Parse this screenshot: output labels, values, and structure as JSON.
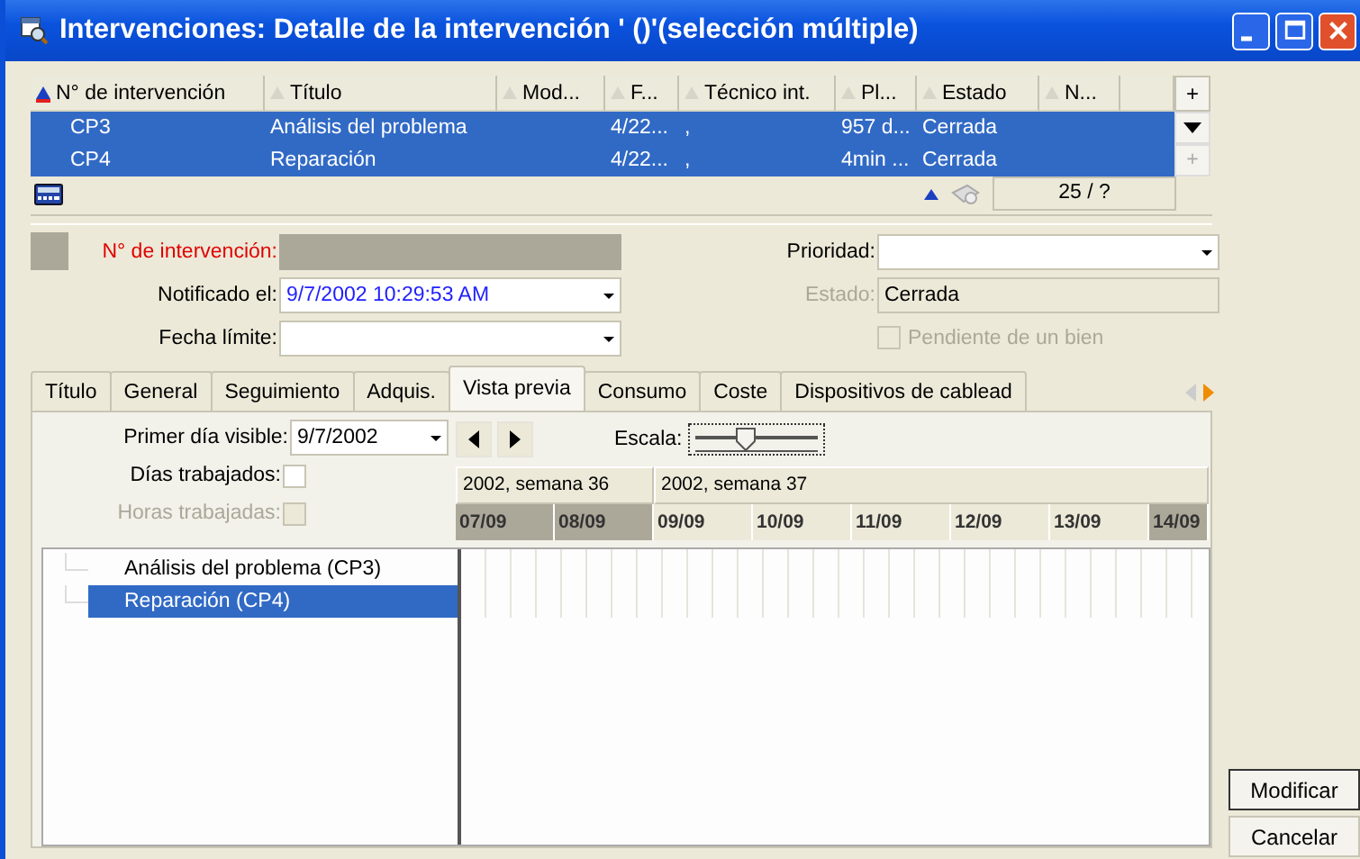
{
  "window": {
    "title": "Intervenciones: Detalle de la intervención ' ()'(selección múltiple)"
  },
  "list": {
    "columns": [
      {
        "label": "N° de intervención",
        "sorted": true
      },
      {
        "label": "Título",
        "sorted": false
      },
      {
        "label": "Mod...",
        "sorted": false
      },
      {
        "label": "F...",
        "sorted": false
      },
      {
        "label": "Técnico int.",
        "sorted": false
      },
      {
        "label": "Pl...",
        "sorted": false
      },
      {
        "label": "Estado",
        "sorted": false
      },
      {
        "label": "N...",
        "sorted": false
      }
    ],
    "rows": [
      {
        "selected": true,
        "cells": [
          "CP3",
          "Análisis del problema",
          "",
          "4/22...",
          ",",
          "957 d...",
          "Cerrada",
          ""
        ]
      },
      {
        "selected": true,
        "cells": [
          "CP4",
          "Reparación",
          "",
          "4/22...",
          ",",
          "4min ...",
          "Cerrada",
          ""
        ]
      }
    ],
    "add_label": "+",
    "counter": "25 / ?"
  },
  "form": {
    "number": {
      "label": "N° de intervención:",
      "required": true
    },
    "notified": {
      "label": "Notificado el:",
      "value": "9/7/2002 10:29:53 AM"
    },
    "deadline": {
      "label": "Fecha límite:"
    },
    "priority": {
      "label": "Prioridad:"
    },
    "status": {
      "label": "Estado:",
      "value": "Cerrada",
      "disabled": true
    },
    "pending": {
      "label": "Pendiente de un bien",
      "checked": false,
      "disabled": true
    }
  },
  "tabs": [
    {
      "label": "Título",
      "selected": false
    },
    {
      "label": "General",
      "selected": false
    },
    {
      "label": "Seguimiento",
      "selected": false
    },
    {
      "label": "Adquis.",
      "selected": false
    },
    {
      "label": "Vista previa",
      "selected": true
    },
    {
      "label": "Consumo",
      "selected": false
    },
    {
      "label": "Coste",
      "selected": false
    },
    {
      "label": "Dispositivos de cablead",
      "selected": false
    }
  ],
  "preview": {
    "first_day": {
      "label": "Primer día visible:",
      "value": "9/7/2002"
    },
    "scale": {
      "label": "Escala:",
      "level": 0.4
    },
    "days_worked": {
      "label": "Días trabajados:",
      "checked": false,
      "disabled": false
    },
    "hours_worked": {
      "label": "Horas trabajadas:",
      "checked": false,
      "disabled": true
    },
    "weeks": [
      {
        "label": "2002, semana 36",
        "days": [
          {
            "label": "07/09",
            "weekend": true
          },
          {
            "label": "08/09",
            "weekend": true
          }
        ]
      },
      {
        "label": "2002, semana 37",
        "days": [
          {
            "label": "09/09",
            "weekend": false
          },
          {
            "label": "10/09",
            "weekend": false
          },
          {
            "label": "11/09",
            "weekend": false
          },
          {
            "label": "12/09",
            "weekend": false
          },
          {
            "label": "13/09",
            "weekend": false
          },
          {
            "label": "14/09",
            "weekend": true
          }
        ]
      }
    ],
    "tasks": [
      {
        "label": "Análisis del problema (CP3)",
        "selected": false
      },
      {
        "label": "Reparación (CP4)",
        "selected": true
      }
    ]
  },
  "buttons": [
    {
      "label": "Modificar",
      "default": true
    },
    {
      "label": "Cancelar",
      "default": false
    }
  ]
}
